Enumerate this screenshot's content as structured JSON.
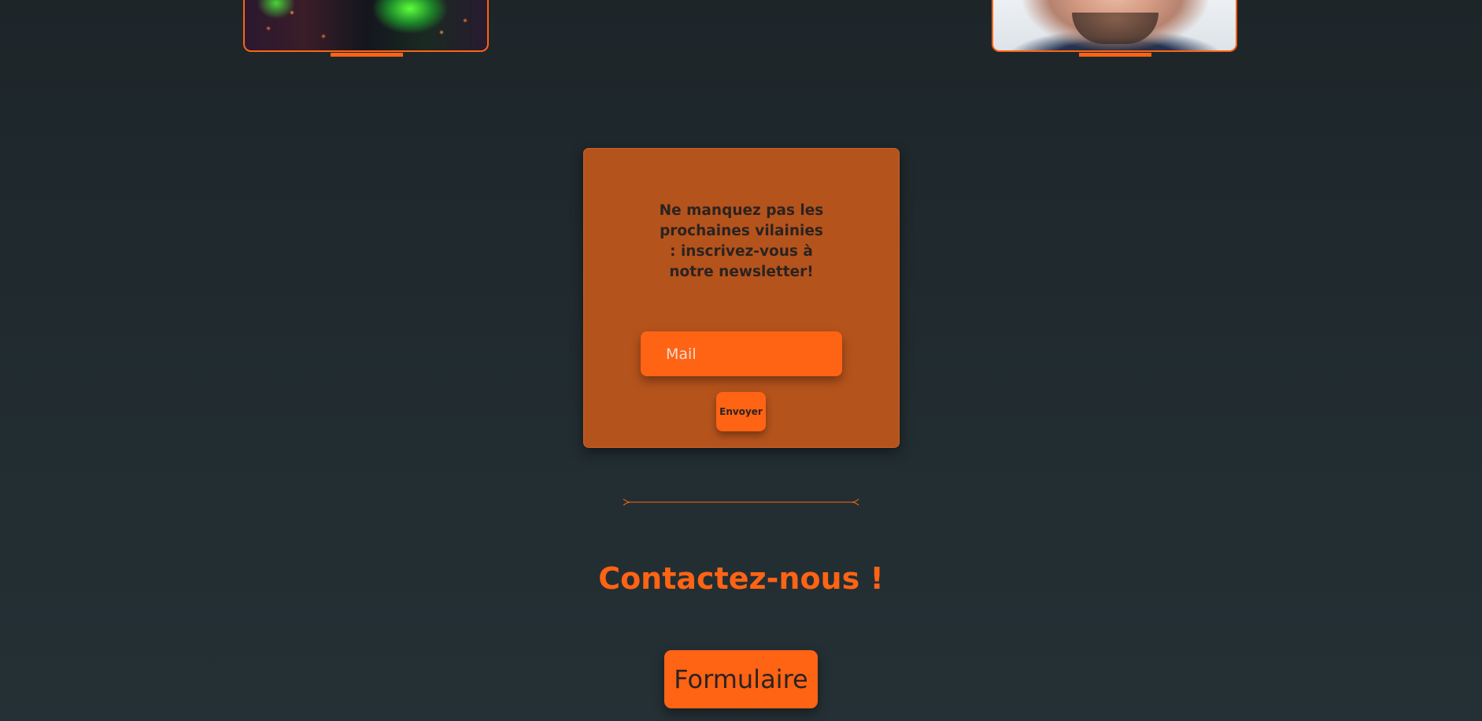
{
  "gallery": {
    "images": [
      {
        "alt": "",
        "accent": "#ff6314"
      },
      {
        "alt": "",
        "accent": "#ff6314"
      }
    ]
  },
  "newsletter": {
    "title": "Ne manquez pas les prochaines vilainies : inscrivez-vous à notre newsletter!",
    "email_placeholder": "Mail",
    "email_value": "",
    "submit_label": "Envoyer"
  },
  "contact": {
    "title": "Contactez-nous !",
    "form_button_label": "Formulaire"
  },
  "colors": {
    "accent": "#ff6314",
    "card_background": "#b5531c",
    "page_background": "#1f282c",
    "dark_text": "#2b2320"
  }
}
